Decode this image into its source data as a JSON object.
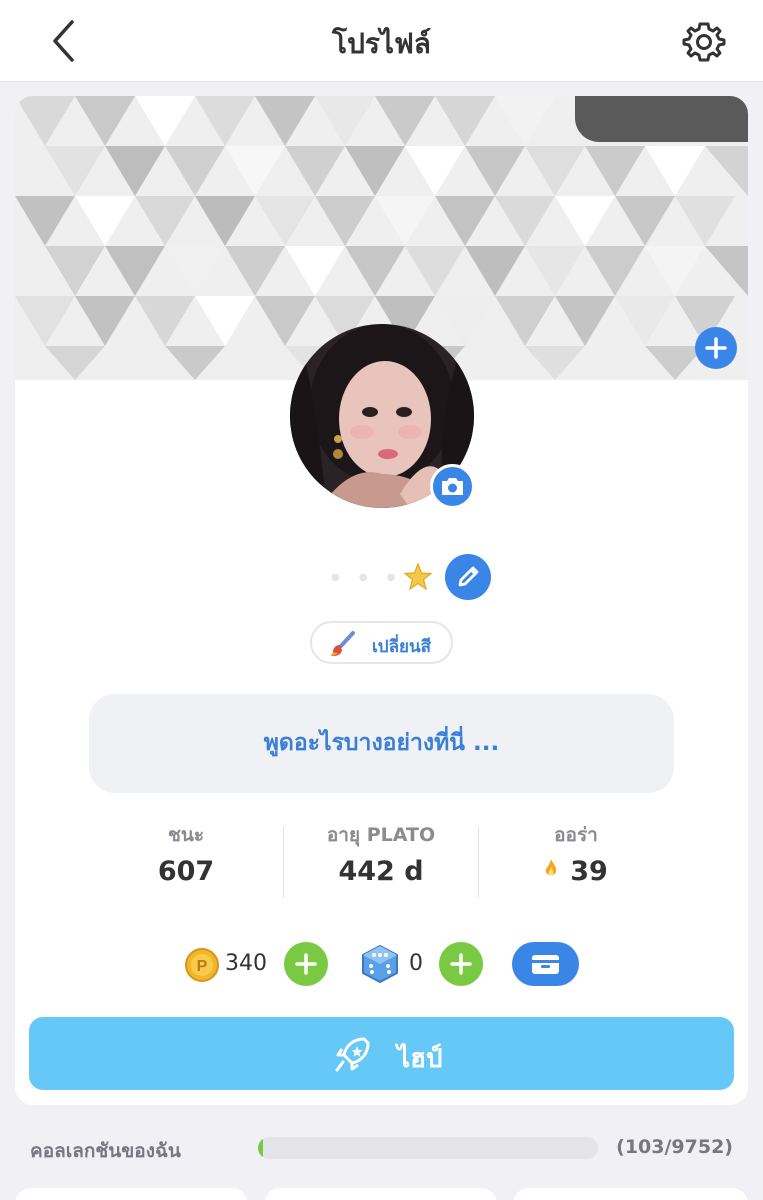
{
  "header": {
    "title": "โปรไฟล์",
    "back_icon": "chevron-left-icon",
    "settings_icon": "gear-icon"
  },
  "profile": {
    "name_icon": "star-icon",
    "edit_icon": "pencil-icon",
    "camera_icon": "camera-icon",
    "cover_add_icon": "plus-icon",
    "change_color_label": "เปลี่ยนสี",
    "status_placeholder": "พูดอะไรบางอย่างที่นี่ ..."
  },
  "stats": [
    {
      "label": "ชนะ",
      "value": "607"
    },
    {
      "label": "อายุ PLATO",
      "value": "442 d"
    },
    {
      "label": "ออร่า",
      "value": "39"
    }
  ],
  "currency": {
    "coins": "340",
    "dice": "0",
    "wallet_icon": "wallet-icon"
  },
  "high_button": {
    "label": "ไฮป์"
  },
  "collection": {
    "label": "คอลเลกชันของฉัน",
    "count": "(103/9752)",
    "progress": 0.0106
  },
  "colors": {
    "accent_blue": "#3a86e6",
    "text_blue": "#3a7fd6",
    "green": "#7ac943",
    "light_blue": "#66c8f7"
  }
}
